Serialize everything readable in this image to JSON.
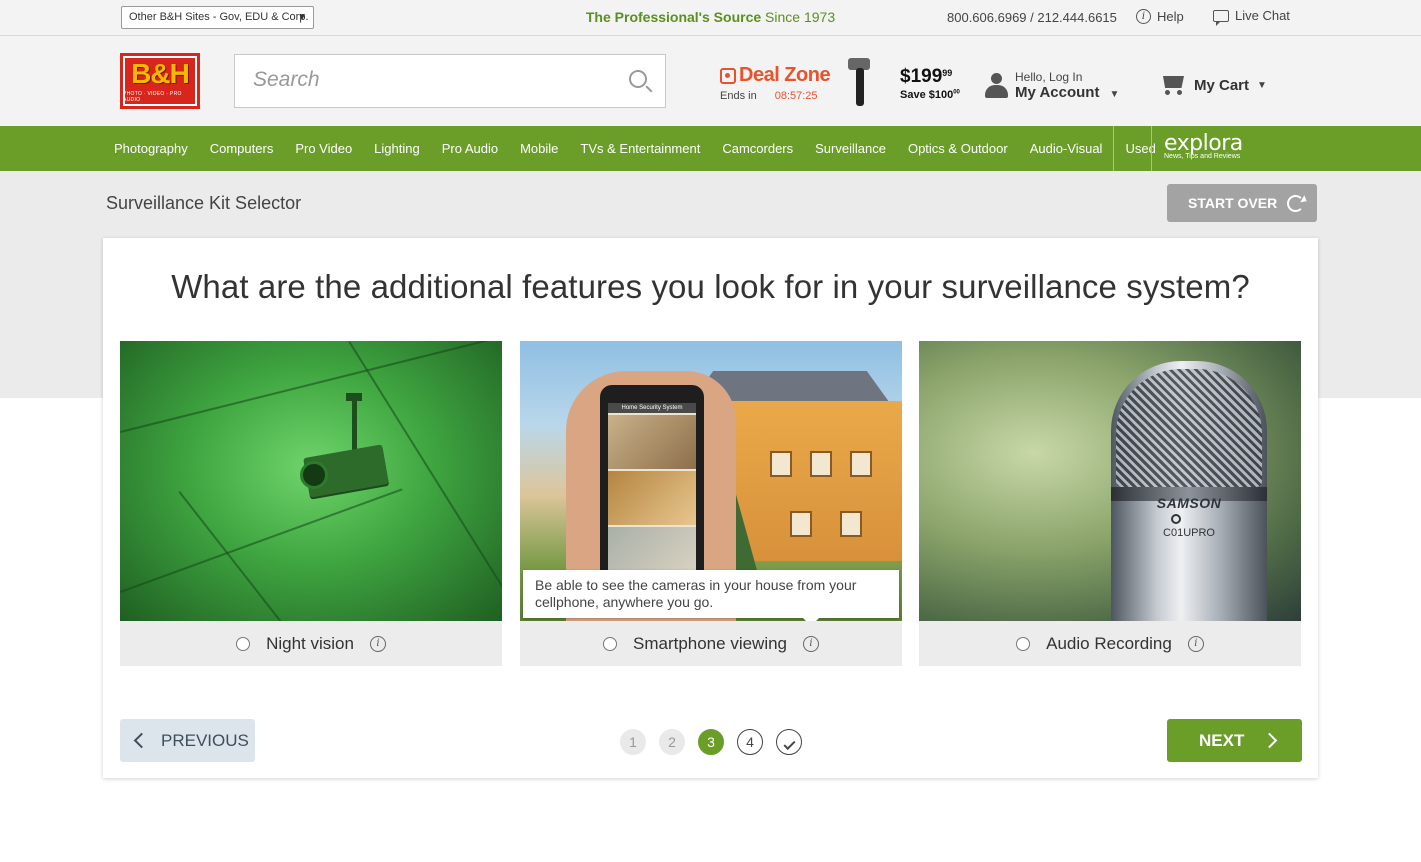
{
  "util": {
    "other_sites": "Other B&H Sites - Gov, EDU & Corp.",
    "tagline_bold": "The Professional's Source",
    "tagline_rest": " Since 1973",
    "phones": "800.606.6969 / 212.444.6615",
    "help": "Help",
    "live_chat": "Live Chat"
  },
  "header": {
    "logo_text": "B&H",
    "logo_sub": "PHOTO · VIDEO · PRO AUDIO",
    "search_placeholder": "Search",
    "deal_zone": "Deal Zone",
    "ends_in": "Ends in",
    "timer": "08:57:25",
    "deal_price": "$199",
    "deal_price_cents": "99",
    "deal_save": "Save $100",
    "deal_save_cents": "00",
    "hello": "Hello, Log In",
    "my_account": "My Account",
    "my_cart": "My Cart"
  },
  "nav": {
    "items": [
      "Photography",
      "Computers",
      "Pro Video",
      "Lighting",
      "Pro Audio",
      "Mobile",
      "TVs & Entertainment",
      "Camcorders",
      "Surveillance",
      "Optics & Outdoor",
      "Audio-Visual",
      "Used"
    ],
    "explora": "explora",
    "explora_sub": "News, Tips and Reviews"
  },
  "page": {
    "title": "Surveillance Kit Selector",
    "start_over": "START OVER",
    "question": "What are the additional features you look for in your surveillance system?"
  },
  "options": [
    {
      "label": "Night vision"
    },
    {
      "label": "Smartphone viewing",
      "tooltip": "Be able to see the cameras in your house from your cellphone, anywhere you go.",
      "screen_title": "Home Security System"
    },
    {
      "label": "Audio Recording",
      "brand": "SAMSON",
      "model": "C01UPRO"
    }
  ],
  "footer": {
    "previous": "PREVIOUS",
    "next": "NEXT",
    "steps": [
      "1",
      "2",
      "3",
      "4"
    ],
    "current_step": 3
  },
  "colors": {
    "brand_green": "#6a9e28",
    "deal_orange": "#e8532b",
    "logo_red": "#d8261c"
  }
}
